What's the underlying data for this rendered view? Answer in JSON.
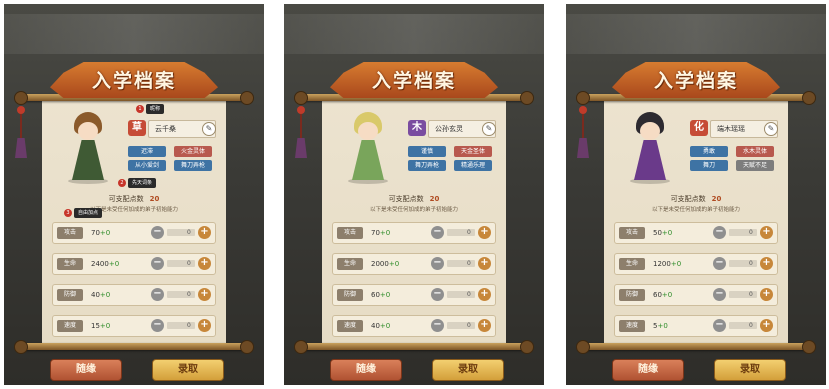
{
  "title": "入学档案",
  "points_label": "可支配点数",
  "points_value": "20",
  "hint": "以下是未受任何加成的弟子初始能力",
  "stat_labels": [
    "攻击",
    "生命",
    "防御",
    "速度"
  ],
  "buttons": {
    "random": "随缘",
    "admit": "录取"
  },
  "panels": [
    {
      "element": "草",
      "element_color": "#c64b36",
      "name": "云千桑",
      "hair_color": "#8b5a2b",
      "robe_color": "#3f5a34",
      "traits": [
        {
          "label": "迟滞",
          "style": "t-blue"
        },
        {
          "label": "火金灵体",
          "style": "t-red"
        },
        {
          "label": "从小爱剑",
          "style": "t-blue"
        },
        {
          "label": "舞刀弄枪",
          "style": "t-blue"
        }
      ],
      "stats": [
        {
          "base": "70",
          "plus": "+0",
          "alloc": "0"
        },
        {
          "base": "2400",
          "plus": "+0",
          "alloc": "0"
        },
        {
          "base": "40",
          "plus": "+0",
          "alloc": "0"
        },
        {
          "base": "15",
          "plus": "+0",
          "alloc": "0"
        }
      ],
      "tips": [
        {
          "num": "1",
          "text": "昵称"
        },
        {
          "num": "2",
          "text": "先天词条"
        },
        {
          "num": "3",
          "text": "自由加点"
        }
      ]
    },
    {
      "element": "木",
      "element_color": "#7a4ca0",
      "name": "公孙玄灵",
      "hair_color": "#d9c96a",
      "robe_color": "#79a55b",
      "traits": [
        {
          "label": "谨慎",
          "style": "t-blue"
        },
        {
          "label": "天金圣体",
          "style": "t-red"
        },
        {
          "label": "舞刀弄枪",
          "style": "t-blue"
        },
        {
          "label": "精通乐理",
          "style": "t-blue"
        }
      ],
      "stats": [
        {
          "base": "70",
          "plus": "+0",
          "alloc": "0"
        },
        {
          "base": "2000",
          "plus": "+0",
          "alloc": "0"
        },
        {
          "base": "60",
          "plus": "+0",
          "alloc": "0"
        },
        {
          "base": "40",
          "plus": "+0",
          "alloc": "0"
        }
      ],
      "tips": []
    },
    {
      "element": "化",
      "element_color": "#c64b36",
      "name": "端木瑶瑶",
      "hair_color": "#2d2a30",
      "robe_color": "#6a3a8a",
      "traits": [
        {
          "label": "勇敢",
          "style": "t-blue"
        },
        {
          "label": "水木灵体",
          "style": "t-red"
        },
        {
          "label": "舞刀",
          "style": "t-blue"
        },
        {
          "label": "天赋不足",
          "style": "t-gray"
        }
      ],
      "stats": [
        {
          "base": "50",
          "plus": "+0",
          "alloc": "0"
        },
        {
          "base": "1200",
          "plus": "+0",
          "alloc": "0"
        },
        {
          "base": "60",
          "plus": "+0",
          "alloc": "0"
        },
        {
          "base": "5",
          "plus": "+0",
          "alloc": "0"
        }
      ],
      "tips": []
    }
  ]
}
